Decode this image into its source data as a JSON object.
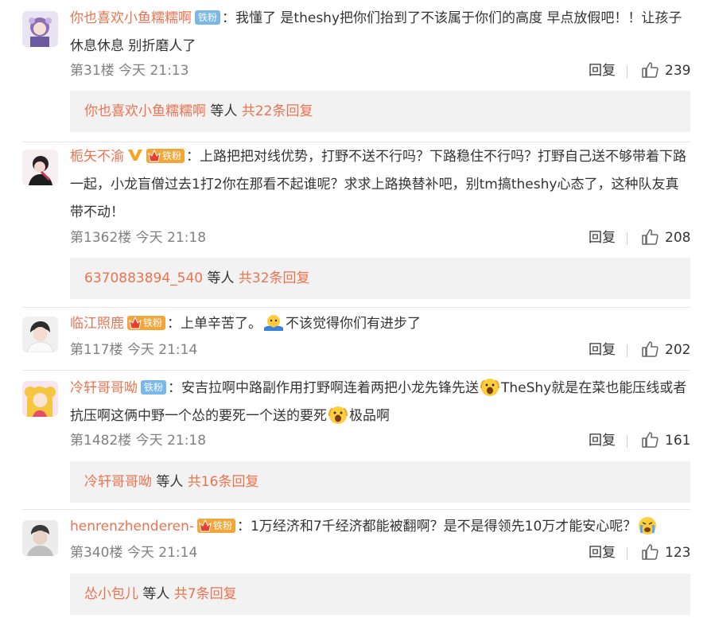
{
  "colors": {
    "accent": "#eb7350",
    "badge_blue": "#7ab8e8",
    "badge_gold": "#f1a63a"
  },
  "comments": [
    {
      "username": "你也喜欢小鱼糯糯啊",
      "badge": "铁粉",
      "text1": "：我懂了 是theshy把你们抬到了不该属于你们的高度 早点放假吧！！让孩子休息休息 别折磨人了",
      "floor": "第31楼",
      "time": "今天 21:13",
      "reply_label": "回复",
      "likes": "239",
      "sub": {
        "users": "你也喜欢小鱼糯糯啊",
        "others": " 等人 ",
        "count": "共22条回复"
      }
    },
    {
      "username": "栀矢不渝",
      "badge": "铁粉",
      "text1": "：上路把把对线优势，打野不送不行吗？下路稳住不行吗？打野自己送不够带着下路一起，小龙盲僧过去1打2你在那看不起谁呢？求求上路换替补吧，别tm搞theshy心态了，这种队友真带不动！",
      "floor": "第1362楼",
      "time": "今天 21:18",
      "reply_label": "回复",
      "likes": "208",
      "sub": {
        "users": "6370883894_540",
        "others": " 等人 ",
        "count": "共32条回复"
      }
    },
    {
      "username": "临江照鹿",
      "badge": "铁粉",
      "text1": "：上单辛苦了。",
      "text2": "不该觉得你们有进步了",
      "floor": "第117楼",
      "time": "今天 21:14",
      "reply_label": "回复",
      "likes": "202"
    },
    {
      "username": "冷轩哥哥呦",
      "badge": "铁粉",
      "text1": "：安吉拉啊中路副作用打野啊连着两把小龙先锋先送",
      "text2": "TheShy就是在菜也能压线或者抗压啊这俩中野一个怂的要死一个送的要死",
      "text3": "极品啊",
      "floor": "第1482楼",
      "time": "今天 21:18",
      "reply_label": "回复",
      "likes": "161",
      "sub": {
        "users": "冷轩哥哥呦",
        "others": " 等人 ",
        "count": "共16条回复"
      }
    },
    {
      "username": "henrenzhenderen-",
      "badge": "铁粉",
      "text1": "：1万经济和7千经济都能被翻啊？是不是得领先10万才能安心呢？",
      "floor": "第340楼",
      "time": "今天 21:14",
      "reply_label": "回复",
      "likes": "123",
      "sub": {
        "users": "怂小包儿",
        "others": " 等人 ",
        "count": "共7条回复"
      }
    }
  ],
  "icons": {
    "like": "thumbs-up-icon",
    "crown": "crown-icon",
    "vip": "v-icon"
  }
}
